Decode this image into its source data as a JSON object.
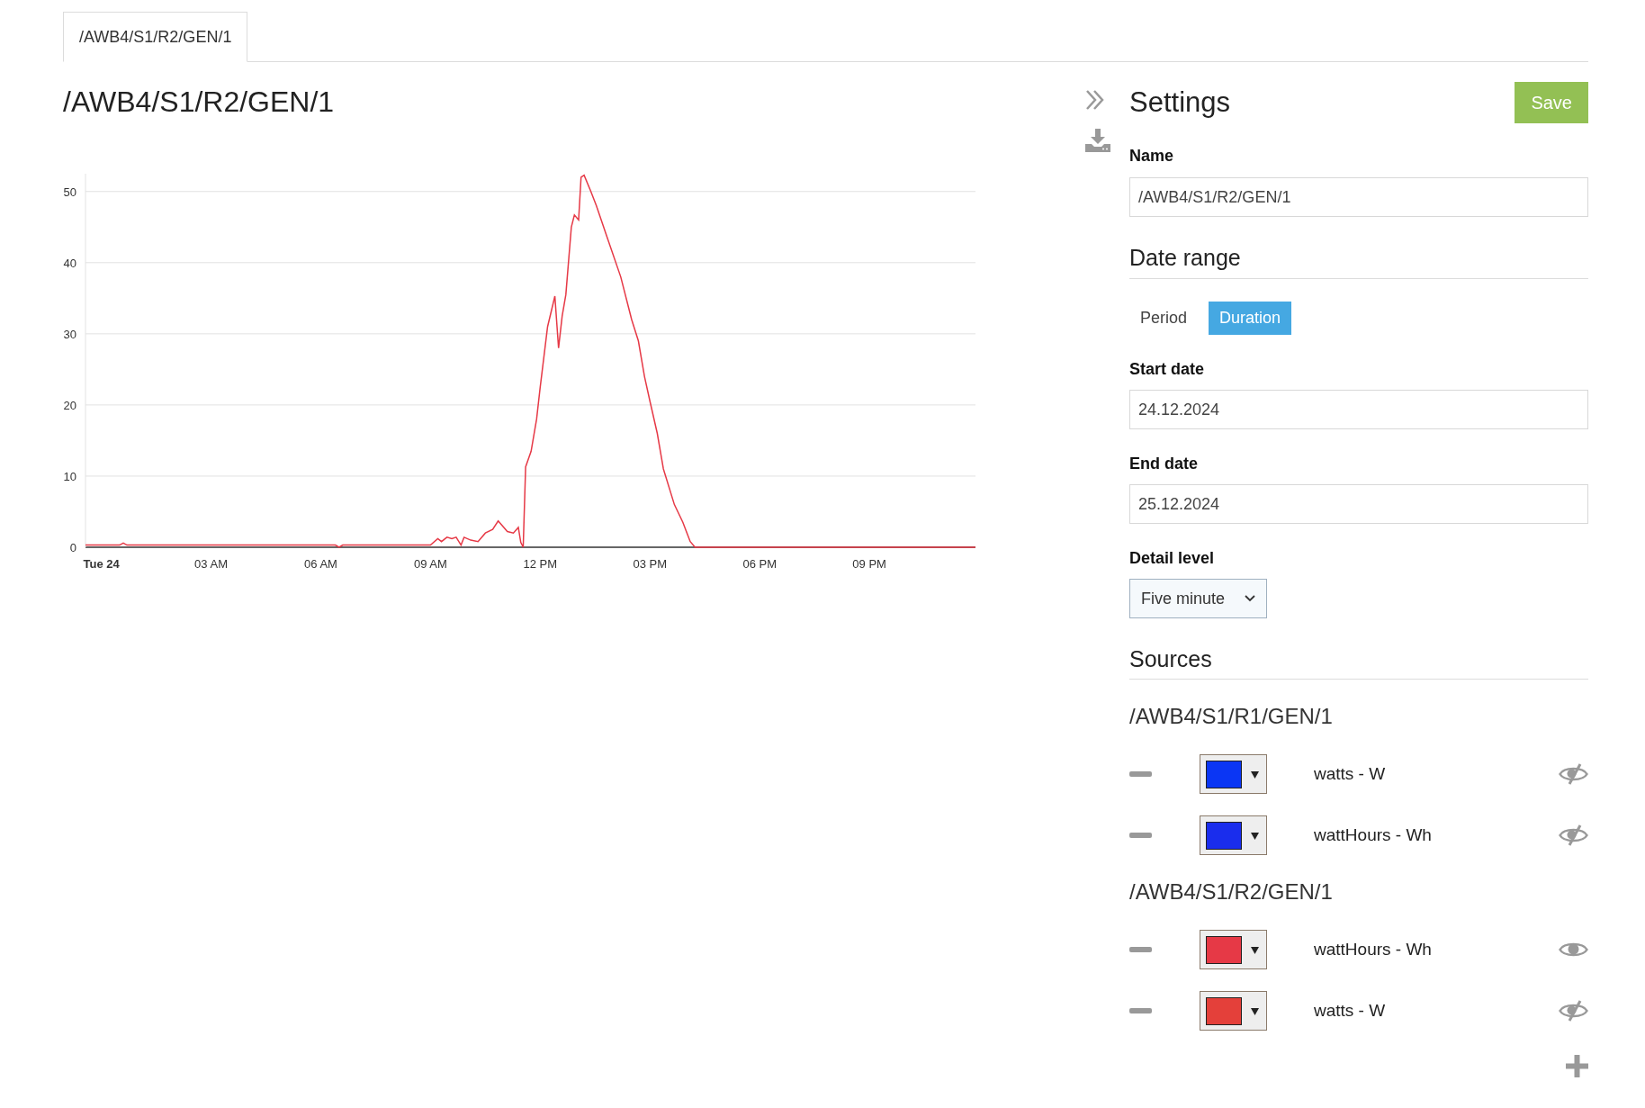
{
  "tabs": [
    {
      "label": "/AWB4/S1/R2/GEN/1",
      "selected": true
    }
  ],
  "chart_panel": {
    "title": "/AWB4/S1/R2/GEN/1",
    "chart_data": {
      "type": "line",
      "grid": true,
      "xlim": [
        "2024-12-23T23:34",
        "2024-12-24T23:54"
      ],
      "ylim": [
        0,
        52.5
      ],
      "xticks": [
        {
          "value": "2024-12-24T00:00",
          "label": "Tue 24"
        },
        {
          "value": "2024-12-24T03:00",
          "label": "03 AM"
        },
        {
          "value": "2024-12-24T06:00",
          "label": "06 AM"
        },
        {
          "value": "2024-12-24T09:00",
          "label": "09 AM"
        },
        {
          "value": "2024-12-24T12:00",
          "label": "12 PM"
        },
        {
          "value": "2024-12-24T15:00",
          "label": "03 PM"
        },
        {
          "value": "2024-12-24T18:00",
          "label": "06 PM"
        },
        {
          "value": "2024-12-24T21:00",
          "label": "09 PM"
        }
      ],
      "yticks": [
        0,
        10,
        20,
        30,
        40,
        50
      ],
      "x": [
        "2024-12-23T23:34",
        "2024-12-24T00:30",
        "2024-12-24T00:36",
        "2024-12-24T00:42",
        "2024-12-24T06:24",
        "2024-12-24T06:30",
        "2024-12-24T06:36",
        "2024-12-24T09:00",
        "2024-12-24T09:12",
        "2024-12-24T09:18",
        "2024-12-24T09:27",
        "2024-12-24T09:35",
        "2024-12-24T09:42",
        "2024-12-24T09:50",
        "2024-12-24T09:55",
        "2024-12-24T10:06",
        "2024-12-24T10:18",
        "2024-12-24T10:30",
        "2024-12-24T10:42",
        "2024-12-24T10:51",
        "2024-12-24T11:06",
        "2024-12-24T11:16",
        "2024-12-24T11:24",
        "2024-12-24T11:28",
        "2024-12-24T11:32",
        "2024-12-24T11:36",
        "2024-12-24T11:45",
        "2024-12-24T11:54",
        "2024-12-24T12:00",
        "2024-12-24T12:12",
        "2024-12-24T12:24",
        "2024-12-24T12:30",
        "2024-12-24T12:36",
        "2024-12-24T12:42",
        "2024-12-24T12:51",
        "2024-12-24T12:56",
        "2024-12-24T13:03",
        "2024-12-24T13:07",
        "2024-12-24T13:12",
        "2024-12-24T13:23",
        "2024-12-24T13:32",
        "2024-12-24T13:48",
        "2024-12-24T14:12",
        "2024-12-24T14:30",
        "2024-12-24T14:41",
        "2024-12-24T14:51",
        "2024-12-24T15:00",
        "2024-12-24T15:12",
        "2024-12-24T15:22",
        "2024-12-24T15:40",
        "2024-12-24T15:54",
        "2024-12-24T16:06",
        "2024-12-24T16:14",
        "2024-12-24T23:54"
      ],
      "series": [
        {
          "color": "#e63946",
          "values": [
            0.3,
            0.3,
            0.6,
            0.3,
            0.3,
            0.0,
            0.3,
            0.3,
            1.2,
            0.8,
            1.4,
            1.2,
            1.4,
            0.3,
            1.4,
            1.0,
            0.8,
            2.0,
            2.5,
            3.7,
            2.2,
            2.0,
            2.8,
            0.7,
            0.0,
            11.3,
            13.5,
            18.0,
            22.5,
            31.0,
            35.3,
            28.0,
            32.5,
            35.5,
            45.0,
            46.7,
            46.0,
            52.0,
            52.3,
            50.0,
            48.0,
            44.0,
            38.0,
            32.0,
            29.0,
            24.0,
            20.5,
            16.0,
            11.0,
            6.0,
            3.5,
            0.8,
            0.0,
            0.0
          ]
        }
      ]
    }
  },
  "settings": {
    "title": "Settings",
    "save_button": "Save",
    "name": {
      "label": "Name",
      "value": "/AWB4/S1/R2/GEN/1"
    },
    "date_range": {
      "title": "Date range",
      "modes": [
        {
          "label": "Period",
          "selected": false
        },
        {
          "label": "Duration",
          "selected": true
        }
      ],
      "start_date": {
        "label": "Start date",
        "value": "24.12.2024"
      },
      "end_date": {
        "label": "End date",
        "value": "25.12.2024"
      },
      "detail_level": {
        "label": "Detail level",
        "value": "Five minute"
      }
    },
    "sources": {
      "title": "Sources",
      "groups": [
        {
          "name": "/AWB4/S1/R1/GEN/1",
          "series": [
            {
              "label": "watts - W",
              "color": "#0b36f4",
              "visible": false
            },
            {
              "label": "wattHours - Wh",
              "color": "#1a2ded",
              "visible": false
            }
          ]
        },
        {
          "name": "/AWB4/S1/R2/GEN/1",
          "series": [
            {
              "label": "wattHours - Wh",
              "color": "#e63946",
              "visible": true
            },
            {
              "label": "watts - W",
              "color": "#e4403a",
              "visible": false
            }
          ]
        }
      ]
    }
  }
}
